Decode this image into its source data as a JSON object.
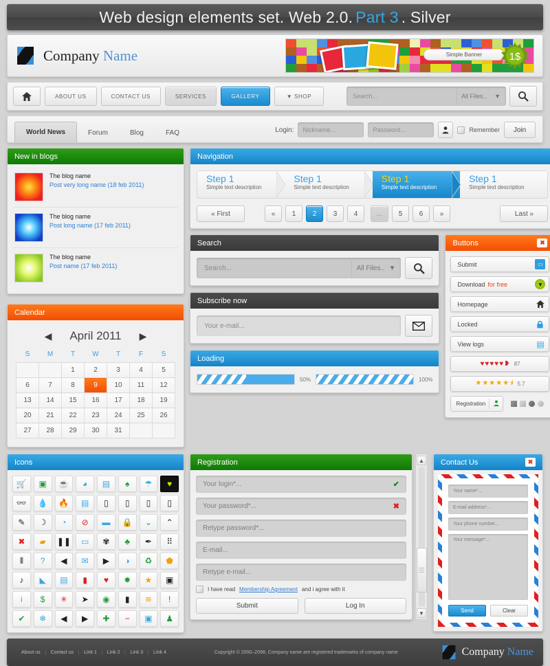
{
  "title": {
    "pre": "Web design elements set. Web 2.0.",
    "highlight": "Part 3",
    "post": ". Silver"
  },
  "header": {
    "company": "Company ",
    "company_accent": "Name",
    "banner_label": "Simple Banner",
    "badge": "1$"
  },
  "nav": {
    "home_icon": "home-icon",
    "items": [
      {
        "label": "ABOUT US",
        "state": "normal"
      },
      {
        "label": "CONTACT US",
        "state": "normal"
      },
      {
        "label": "SERVICES",
        "state": "hover"
      },
      {
        "label": "GALLERY",
        "state": "active"
      },
      {
        "label": "▼ SHOP",
        "state": "normal"
      }
    ],
    "search_placeholder": "Search...",
    "filter_value": "All Files..",
    "search_icon": "magnifier-icon"
  },
  "tabs": {
    "items": [
      {
        "label": "World News",
        "selected": true
      },
      {
        "label": "Forum",
        "selected": false
      },
      {
        "label": "Blog",
        "selected": false
      },
      {
        "label": "FAQ",
        "selected": false
      }
    ],
    "login_label": "Login:",
    "nickname_placeholder": "Nickname...",
    "password_placeholder": "Password...",
    "user_icon": "user-icon",
    "remember_label": "Remember",
    "join_label": "Join"
  },
  "blogs": {
    "title": "New in blogs",
    "items": [
      {
        "name": "The blog name",
        "post": "Post very long name (18 feb 2011)",
        "color": "red"
      },
      {
        "name": "The blog name",
        "post": "Post long name (17 feb 2011)",
        "color": "blue"
      },
      {
        "name": "The blog name",
        "post": "Post name (17 feb 2011)",
        "color": "green"
      }
    ]
  },
  "calendar": {
    "title": "Calendar",
    "month": "April 2011",
    "prev_icon": "chevron-left-icon",
    "next_icon": "chevron-right-icon",
    "daynames": [
      "S",
      "M",
      "T",
      "W",
      "T",
      "F",
      "S"
    ],
    "weeks": [
      [
        "",
        "",
        "1",
        "2",
        "3",
        "4",
        "5"
      ],
      [
        "6",
        "7",
        "8",
        "9",
        "10",
        "11",
        "12"
      ],
      [
        "13",
        "14",
        "15",
        "16",
        "17",
        "18",
        "19"
      ],
      [
        "20",
        "21",
        "22",
        "23",
        "24",
        "25",
        "26"
      ],
      [
        "27",
        "28",
        "29",
        "30",
        "31",
        "",
        ""
      ]
    ],
    "selected_day": "9"
  },
  "navigation": {
    "title": "Navigation",
    "steps": [
      {
        "name": "Step 1",
        "desc": "Simple text description",
        "active": false
      },
      {
        "name": "Step 1",
        "desc": "Simple text description",
        "active": false
      },
      {
        "name": "Step 1",
        "desc": "Simple text description",
        "active": true
      },
      {
        "name": "Step 1",
        "desc": "Simple text description",
        "active": false
      }
    ],
    "pager": {
      "first": "« First",
      "prev": "«",
      "pages": [
        "1",
        "2",
        "3",
        "4",
        "…",
        "5",
        "6"
      ],
      "current": "2",
      "next": "»",
      "last": "Last »"
    }
  },
  "search_panel": {
    "title": "Search",
    "placeholder": "Search...",
    "filter_value": "All Files..",
    "button_icon": "magnifier-icon"
  },
  "subscribe_panel": {
    "title": "Subscribe now",
    "placeholder": "Your e-mail...",
    "button_icon": "envelope-icon"
  },
  "loading_panel": {
    "title": "Loading",
    "bars": [
      {
        "pct": 50,
        "label": "50%"
      },
      {
        "pct": 100,
        "label": "100%"
      }
    ]
  },
  "buttons_panel": {
    "title": "Buttons",
    "close_icon": "close-icon",
    "items": [
      {
        "label": "Submit",
        "icon": "card-icon",
        "accent": ""
      },
      {
        "label": "Download ",
        "accent": "for free",
        "icon": "download-circle-icon"
      },
      {
        "label": "Homepage",
        "icon": "home-icon",
        "accent": ""
      },
      {
        "label": "Locked",
        "icon": "lock-icon",
        "accent": ""
      },
      {
        "label": "View logs",
        "icon": "document-icon",
        "accent": ""
      }
    ],
    "hearts": {
      "filled": 5,
      "half": true,
      "value": "87"
    },
    "stars": {
      "filled": 5,
      "half": true,
      "value": "5.7"
    },
    "registration_label": "Registration",
    "registration_icon": "user-icon"
  },
  "icons_panel": {
    "title": "Icons",
    "icons": [
      {
        "name": "shopping-cart-icon",
        "glyph": "🛒",
        "color": "#3ba7e0"
      },
      {
        "name": "camera-icon",
        "glyph": "▣",
        "color": "#1f9e3a"
      },
      {
        "name": "coffee-icon",
        "glyph": "☕",
        "color": "#222"
      },
      {
        "name": "pie-chart-icon",
        "glyph": "◕",
        "color": "#3ba7e0"
      },
      {
        "name": "mp3-player-icon",
        "glyph": "▤",
        "color": "#3ba7e0"
      },
      {
        "name": "tree-icon",
        "glyph": "♠",
        "color": "#1f9e3a"
      },
      {
        "name": "umbrella-icon",
        "glyph": "☂",
        "color": "#3ba7e0"
      },
      {
        "name": "heart-badge-icon",
        "glyph": "♥",
        "color": "#c8e600",
        "dark": true
      },
      {
        "name": "glasses-icon",
        "glyph": "👓",
        "color": "#3ba7e0"
      },
      {
        "name": "water-drop-icon",
        "glyph": "💧",
        "color": "#3ba7e0"
      },
      {
        "name": "flame-icon",
        "glyph": "🔥",
        "color": "#e02020"
      },
      {
        "name": "clipboard-icon",
        "glyph": "▤",
        "color": "#3ba7e0"
      },
      {
        "name": "phone-1-icon",
        "glyph": "▯",
        "color": "#222"
      },
      {
        "name": "phone-2-icon",
        "glyph": "▯",
        "color": "#222"
      },
      {
        "name": "phone-3-icon",
        "glyph": "▯",
        "color": "#222"
      },
      {
        "name": "phone-4-icon",
        "glyph": "▯",
        "color": "#222"
      },
      {
        "name": "pen-icon",
        "glyph": "✎",
        "color": "#222"
      },
      {
        "name": "moon-icon",
        "glyph": "☽",
        "color": "#222"
      },
      {
        "name": "clock-icon",
        "glyph": "◔",
        "color": "#3ba7e0"
      },
      {
        "name": "forbidden-icon",
        "glyph": "⊘",
        "color": "#e02020"
      },
      {
        "name": "briefcase-icon",
        "glyph": "▬",
        "color": "#3ba7e0"
      },
      {
        "name": "lock-icon",
        "glyph": "🔒",
        "color": "#3ba7e0"
      },
      {
        "name": "chevron-double-down-icon",
        "glyph": "⌄",
        "color": "#1f9e3a"
      },
      {
        "name": "chevron-double-up-icon",
        "glyph": "⌃",
        "color": "#222"
      },
      {
        "name": "close-x-icon",
        "glyph": "✖",
        "color": "#e02020"
      },
      {
        "name": "folder-icon",
        "glyph": "▰",
        "color": "#f0a010"
      },
      {
        "name": "pause-icon",
        "glyph": "❚❚",
        "color": "#222"
      },
      {
        "name": "chat-bubble-icon",
        "glyph": "▭",
        "color": "#3ba7e0"
      },
      {
        "name": "gear-icon",
        "glyph": "✾",
        "color": "#222"
      },
      {
        "name": "pin-icon",
        "glyph": "♣",
        "color": "#1f9e3a"
      },
      {
        "name": "brush-icon",
        "glyph": "✒",
        "color": "#222"
      },
      {
        "name": "fullscreen-icon",
        "glyph": "⠿",
        "color": "#222"
      },
      {
        "name": "equalizer-icon",
        "glyph": "⦀",
        "color": "#222"
      },
      {
        "name": "help-icon",
        "glyph": "?",
        "color": "#3ba7e0"
      },
      {
        "name": "volume-icon",
        "glyph": "◀",
        "color": "#222"
      },
      {
        "name": "mail-icon",
        "glyph": "✉",
        "color": "#3ba7e0"
      },
      {
        "name": "play-icon",
        "glyph": "▶",
        "color": "#222"
      },
      {
        "name": "globe-cd-icon",
        "glyph": "◑",
        "color": "#3ba7e0"
      },
      {
        "name": "recycle-icon",
        "glyph": "♻",
        "color": "#1f9e3a"
      },
      {
        "name": "shield-icon",
        "glyph": "⬟",
        "color": "#f0a010"
      },
      {
        "name": "music-note-icon",
        "glyph": "♪",
        "color": "#222"
      },
      {
        "name": "tag-icon",
        "glyph": "◣",
        "color": "#3ba7e0"
      },
      {
        "name": "printer-icon",
        "glyph": "▤",
        "color": "#3ba7e0"
      },
      {
        "name": "bar-chart-icon",
        "glyph": "▮",
        "color": "#e02020"
      },
      {
        "name": "heart-icon",
        "glyph": "♥",
        "color": "#e02020"
      },
      {
        "name": "globe-icon",
        "glyph": "✸",
        "color": "#1f9e3a"
      },
      {
        "name": "star-icon",
        "glyph": "★",
        "color": "#f0a010"
      },
      {
        "name": "video-camera-icon",
        "glyph": "▣",
        "color": "#222"
      },
      {
        "name": "info-icon",
        "glyph": "i",
        "color": "#3ba7e0"
      },
      {
        "name": "dollar-icon",
        "glyph": "$",
        "color": "#1f9e3a"
      },
      {
        "name": "asterisk-icon",
        "glyph": "✳",
        "color": "#e02020"
      },
      {
        "name": "cursor-icon",
        "glyph": "➤",
        "color": "#222"
      },
      {
        "name": "eye-icon",
        "glyph": "◉",
        "color": "#1f9e3a"
      },
      {
        "name": "trash-icon",
        "glyph": "▮",
        "color": "#222"
      },
      {
        "name": "rss-icon",
        "glyph": "≋",
        "color": "#f0a010"
      },
      {
        "name": "exclamation-icon",
        "glyph": "!",
        "color": "#e02020"
      },
      {
        "name": "check-icon",
        "glyph": "✔",
        "color": "#1f9e3a"
      },
      {
        "name": "snowflake-icon",
        "glyph": "❄",
        "color": "#3ba7e0"
      },
      {
        "name": "arrow-left-icon",
        "glyph": "◀",
        "color": "#222"
      },
      {
        "name": "arrow-right-icon",
        "glyph": "▶",
        "color": "#222"
      },
      {
        "name": "plus-icon",
        "glyph": "✚",
        "color": "#1f9e3a"
      },
      {
        "name": "minus-icon",
        "glyph": "−",
        "color": "#e02020"
      },
      {
        "name": "save-icon",
        "glyph": "▣",
        "color": "#3ba7e0"
      },
      {
        "name": "user-icon",
        "glyph": "♟",
        "color": "#1f9e3a"
      }
    ]
  },
  "registration_panel": {
    "title": "Registration",
    "fields": [
      {
        "placeholder": "Your login*...",
        "status": "ok"
      },
      {
        "placeholder": "Your password*...",
        "status": "error"
      },
      {
        "placeholder": "Retype password*...",
        "status": ""
      },
      {
        "placeholder": "E-mail...",
        "status": ""
      },
      {
        "placeholder": "Retype e-mail...",
        "status": ""
      }
    ],
    "agree_pre": "I have read ",
    "agree_link": "Membership Agreement",
    "agree_post": " and i agree with it",
    "submit_label": "Submit",
    "login_label": "Log In"
  },
  "contact_panel": {
    "title": "Contact Us",
    "close_icon": "close-icon",
    "name_placeholder": "Your name*...",
    "email_placeholder": "E-mail address*...",
    "phone_placeholder": "Your phone number...",
    "message_placeholder": "Your message*...",
    "send_label": "Send",
    "clear_label": "Clear"
  },
  "footer": {
    "links": [
      "About us",
      "Contact us",
      "Link 1",
      "Link 2",
      "Link 3",
      "Link 4"
    ],
    "copyright": "Copyright © 2000–2098, Company name are registered trademarks of company name",
    "company": "Company ",
    "company_accent": "Name"
  },
  "colors": {
    "accent_blue": "#1a8bd0",
    "accent_orange": "#f24d04",
    "accent_green": "#0f7a05",
    "dark": "#3f3f3f",
    "link": "#2c7fd4"
  }
}
